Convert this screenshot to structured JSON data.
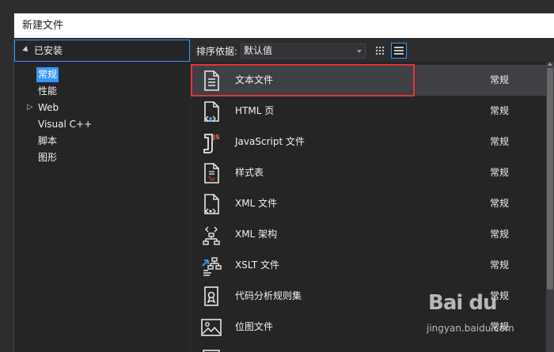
{
  "window": {
    "title": "新建文件"
  },
  "left": {
    "installed": "已安装",
    "tree": [
      {
        "label": "常规",
        "selected": true
      },
      {
        "label": "性能"
      },
      {
        "label": "Web",
        "expandable": true
      },
      {
        "label": "Visual C++"
      },
      {
        "label": "脚本"
      },
      {
        "label": "图形"
      }
    ]
  },
  "toolbar": {
    "sort_label": "排序依据:",
    "sort_value": "默认值"
  },
  "templates": [
    {
      "name": "文本文件",
      "category": "常规",
      "icon": "text-file-icon",
      "selected": true
    },
    {
      "name": "HTML 页",
      "category": "常规",
      "icon": "html-file-icon"
    },
    {
      "name": "JavaScript 文件",
      "category": "常规",
      "icon": "javascript-file-icon"
    },
    {
      "name": "样式表",
      "category": "常规",
      "icon": "stylesheet-icon"
    },
    {
      "name": "XML 文件",
      "category": "常规",
      "icon": "xml-file-icon"
    },
    {
      "name": "XML 架构",
      "category": "常规",
      "icon": "xml-schema-icon"
    },
    {
      "name": "XSLT 文件",
      "category": "常规",
      "icon": "xslt-file-icon"
    },
    {
      "name": "代码分析规则集",
      "category": "常规",
      "icon": "rule-set-icon"
    },
    {
      "name": "位图文件",
      "category": "常规",
      "icon": "bitmap-icon"
    }
  ],
  "watermark": {
    "brand": "Bai du",
    "url": "jingyan.baidu.com"
  },
  "colors": {
    "accent": "#3399ff",
    "highlight": "#e0353a",
    "background": "#2d2d30",
    "panel": "#252526"
  }
}
